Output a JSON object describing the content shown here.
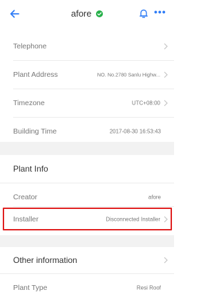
{
  "header": {
    "title": "afore",
    "status_icon": "check-circle-icon",
    "status_color": "#27b04a",
    "accent_color": "#2e7cf6",
    "more_label": "•••"
  },
  "plant_rows": [
    {
      "label": "Telephone",
      "value": ""
    },
    {
      "label": "Plant Address",
      "value": "NO. No.2780 Sanlu Highw..."
    },
    {
      "label": "Timezone",
      "value": "UTC+08:00"
    },
    {
      "label": "Building Time",
      "value": "2017-08-30 16:53:43"
    }
  ],
  "plant_info": {
    "title": "Plant Info",
    "rows": [
      {
        "label": "Creator",
        "value": "afore"
      },
      {
        "label": "Installer",
        "value": "Disconnected Installer"
      }
    ]
  },
  "other_info": {
    "title": "Other information",
    "rows": [
      {
        "label": "Plant Type",
        "value": "Resi Roof"
      }
    ]
  }
}
